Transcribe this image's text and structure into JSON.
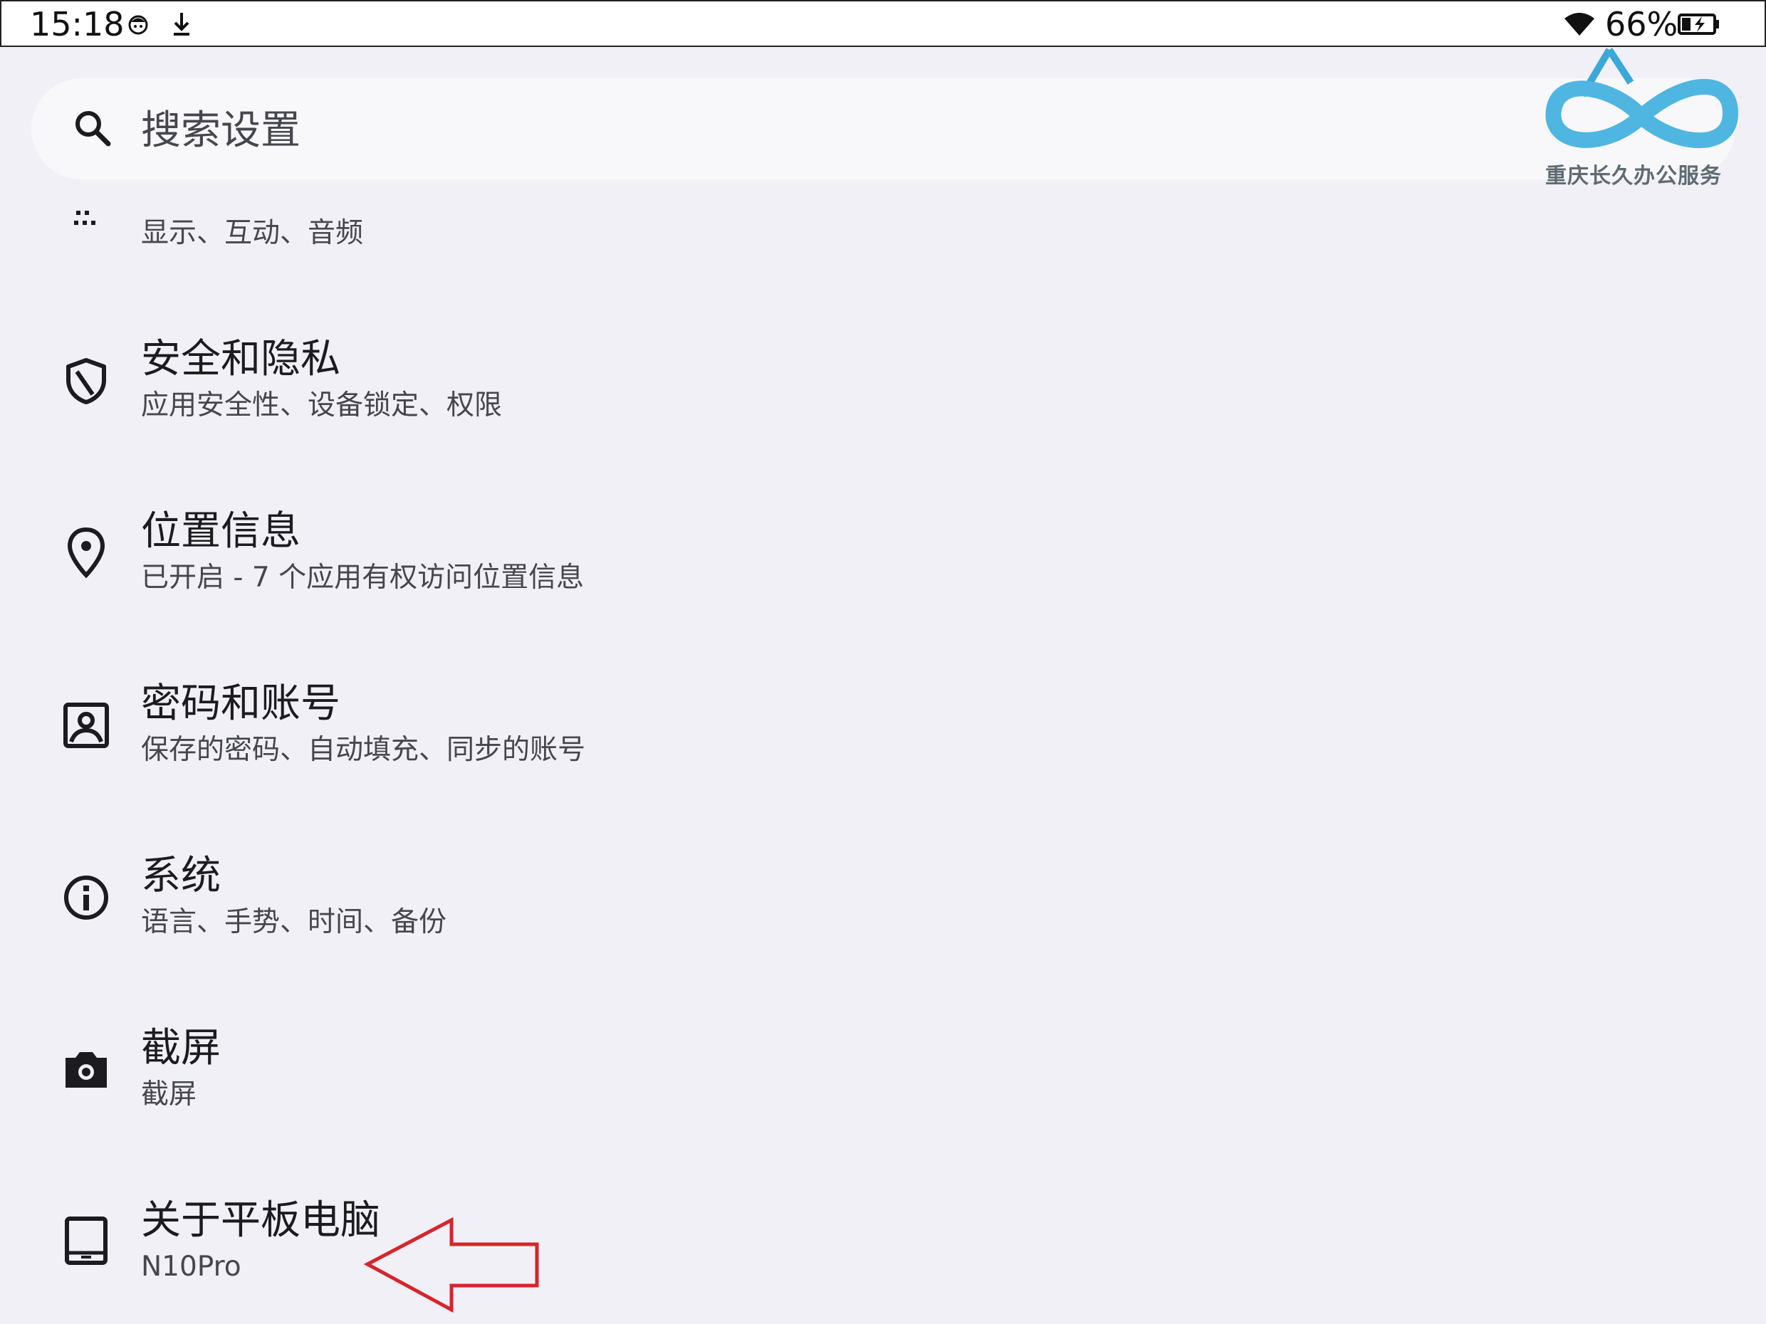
{
  "status_bar": {
    "time": "15:18",
    "icons": [
      "notification-face-icon",
      "download-icon",
      "wifi-icon",
      "battery-charging-icon"
    ],
    "battery": "66%"
  },
  "search": {
    "placeholder": "搜索设置"
  },
  "watermark": {
    "text": "重庆长久办公服务",
    "colors": [
      "#3aa8d8",
      "#4fc0e8"
    ]
  },
  "settings": {
    "items": [
      {
        "title": "",
        "subtitle": "显示、互动、音频",
        "icon": "accessibility-icon"
      },
      {
        "title": "安全和隐私",
        "subtitle": "应用安全性、设备锁定、权限",
        "icon": "shield-icon"
      },
      {
        "title": "位置信息",
        "subtitle": "已开启 - 7 个应用有权访问位置信息",
        "icon": "location-pin-icon"
      },
      {
        "title": "密码和账号",
        "subtitle": "保存的密码、自动填充、同步的账号",
        "icon": "account-box-icon"
      },
      {
        "title": "系统",
        "subtitle": "语言、手势、时间、备份",
        "icon": "info-icon"
      },
      {
        "title": "截屏",
        "subtitle": "截屏",
        "icon": "camera-icon"
      },
      {
        "title": "关于平板电脑",
        "subtitle": "N10Pro",
        "icon": "tablet-icon"
      }
    ]
  },
  "annotation": {
    "arrow_color": "#d6252c"
  }
}
